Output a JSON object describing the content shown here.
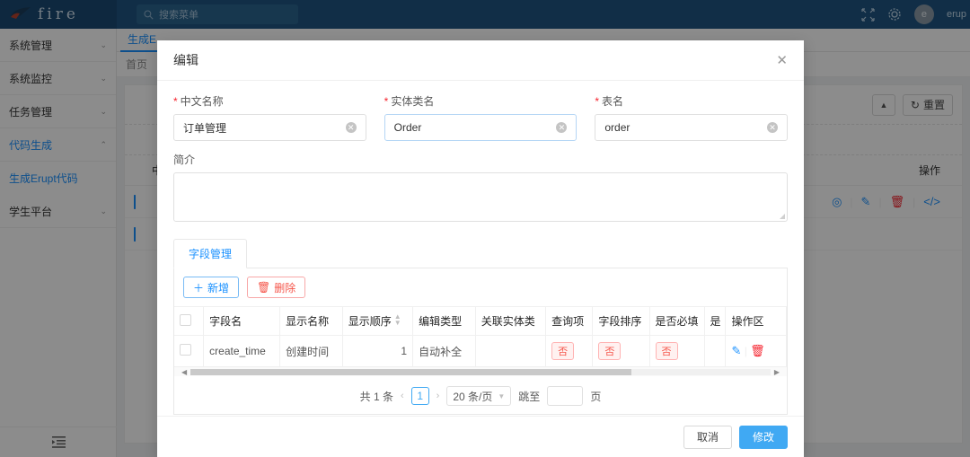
{
  "topbar": {
    "logo_text": "fire",
    "search_placeholder": "搜索菜单",
    "avatar_letter": "e",
    "user_name": "erup",
    "fullscreen_icon": "fullscreen-icon",
    "settings_icon": "gear-icon",
    "search_icon": "search-icon"
  },
  "sidebar": {
    "items": [
      {
        "label": "系统管理",
        "expandable": true
      },
      {
        "label": "系统监控",
        "expandable": true
      },
      {
        "label": "任务管理",
        "expandable": true
      },
      {
        "label": "代码生成",
        "expandable": true
      },
      {
        "label": "生成Erupt代码",
        "expandable": false
      },
      {
        "label": "学生平台",
        "expandable": true
      }
    ],
    "collapse_icon": "menu-collapse-icon"
  },
  "page": {
    "tab_label": "生成E",
    "breadcrumb": "首页",
    "toolbar": {
      "collapse_label": "▲",
      "reset_label": "重置"
    },
    "table": {
      "op_header": "操作",
      "col_header": "中文"
    }
  },
  "modal": {
    "title": "编辑",
    "close_icon": "close-icon",
    "fields": [
      {
        "label": "中文名称",
        "required": true,
        "value": "订单管理"
      },
      {
        "label": "实体类名",
        "required": true,
        "value": "Order"
      },
      {
        "label": "表名",
        "required": true,
        "value": "order"
      }
    ],
    "desc": {
      "label": "简介",
      "value": ""
    },
    "tab": {
      "label": "字段管理"
    },
    "actions": {
      "add_label": "新增",
      "delete_label": "删除"
    },
    "table": {
      "columns": [
        "字段名",
        "显示名称",
        "显示顺序",
        "编辑类型",
        "关联实体类",
        "查询项",
        "字段排序",
        "是否必填",
        "是",
        "操作区"
      ],
      "rows": [
        {
          "field_name": "create_time",
          "display_name": "创建时间",
          "display_order": "1",
          "edit_type": "自动补全",
          "related_entity": "",
          "query_item": "否",
          "field_sort": "否",
          "required": "否",
          "truncated": "",
          "ops": [
            "edit-icon",
            "delete-icon"
          ]
        }
      ]
    },
    "pagination": {
      "total_text": "共 1 条",
      "prev": "‹",
      "current_page": "1",
      "next": "›",
      "page_size": "20 条/页",
      "jump_label": "跳至",
      "jump_value": "",
      "jump_unit": "页"
    },
    "footer": {
      "cancel_label": "取消",
      "confirm_label": "修改"
    }
  },
  "colors": {
    "header_blue": "#1f5582",
    "primary": "#40a9f3",
    "link": "#1890ff",
    "danger": "#f5554a"
  }
}
